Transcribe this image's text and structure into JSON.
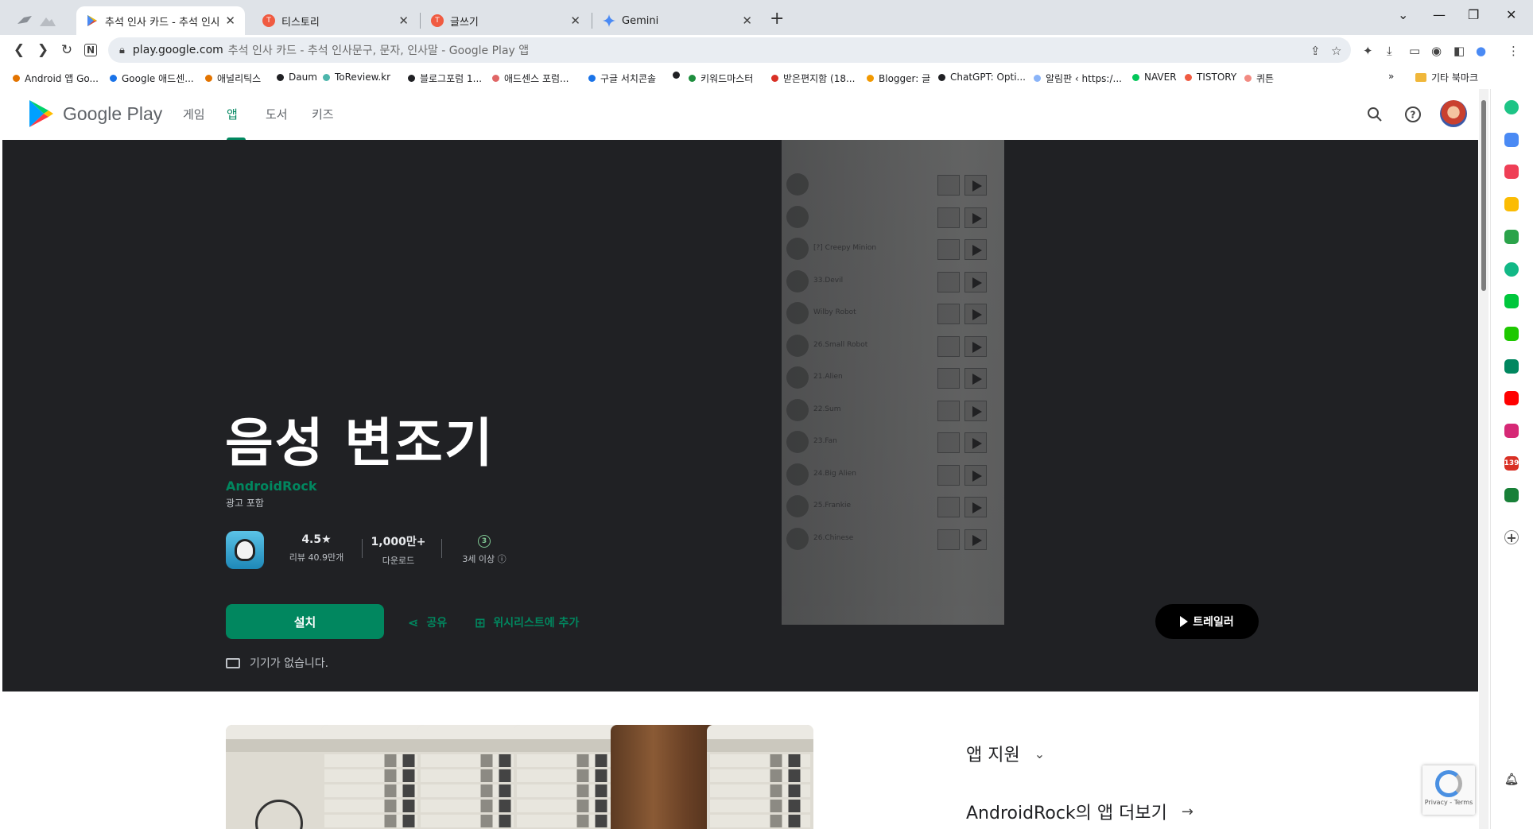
{
  "tabs": [
    {
      "title": "추석 인사 카드 - 추석 인사문구, 문자, 인사말",
      "active": true,
      "favicon_color": "#01875f"
    },
    {
      "title": "티스토리",
      "active": false,
      "favicon_color": "#f05b41"
    },
    {
      "title": "글쓰기",
      "active": false,
      "favicon_color": "#f05b41"
    },
    {
      "title": "Gemini",
      "active": false,
      "favicon_color": "#4a8af4"
    }
  ],
  "omnibox": {
    "host": "play.google.com",
    "path": "추석 인사 카드 - 추석 인사문구, 문자, 인사말 - Google Play 앱"
  },
  "bookmarks": [
    {
      "label": "Android 앱 Go...",
      "color": "#e37400"
    },
    {
      "label": "Google 애드센...",
      "color": "#1a73e8"
    },
    {
      "label": "애널리틱스",
      "color": "#e37400"
    },
    {
      "label": "Daum",
      "color": "#202124"
    },
    {
      "label": "ToReview.kr",
      "color": "#4db6ac"
    },
    {
      "label": "블로그포럼 1...",
      "color": "#202124"
    },
    {
      "label": "애드센스 포럼...",
      "color": "#e06666"
    },
    {
      "label": "구글 서치콘솔",
      "color": "#1a73e8"
    },
    {
      "label": "",
      "color": "#202124"
    },
    {
      "label": "키워드마스터",
      "color": "#1e8e3e"
    },
    {
      "label": "받은편지함 (18...",
      "color": "#d93025"
    },
    {
      "label": "Blogger: 글",
      "color": "#f29900"
    },
    {
      "label": "ChatGPT: Opti...",
      "color": "#202124"
    },
    {
      "label": "알림판 ‹ https:/...",
      "color": "#8ab4f8"
    },
    {
      "label": "NAVER",
      "color": "#03c75a"
    },
    {
      "label": "TISTORY",
      "color": "#f05b41"
    },
    {
      "label": "퀴튼",
      "color": "#f28b82"
    }
  ],
  "bookmarks_more": "»",
  "bookmarks_folder": "기타 북마크",
  "gp": {
    "brand": "Google Play",
    "nav": [
      "게임",
      "앱",
      "도서",
      "키즈"
    ],
    "active_nav": "앱"
  },
  "app": {
    "title": "음성 변조기",
    "developer": "AndroidRock",
    "ads": "광고 포함",
    "rating": "4.5★",
    "reviews": "리뷰 40.9만개",
    "downloads": "1,000만+",
    "downloads_label": "다운로드",
    "age_badge": "3",
    "age_label": "3세 이상 ⓘ",
    "install": "설치",
    "share": "공유",
    "wishlist": "위시리스트에 추가",
    "device_note": "기기가 없습니다.",
    "trailer": "트레일러"
  },
  "hero_list": [
    {
      "label": ""
    },
    {
      "label": ""
    },
    {
      "label": "[?] Creepy Minion"
    },
    {
      "label": "33.Devil"
    },
    {
      "label": "Wilby Robot"
    },
    {
      "label": "26.Small Robot"
    },
    {
      "label": "21.Alien"
    },
    {
      "label": "22.Sum"
    },
    {
      "label": "23.Fan"
    },
    {
      "label": "24.Big Alien"
    },
    {
      "label": "25.Frankie"
    },
    {
      "label": "26.Chinese"
    }
  ],
  "support_heading": "앱 지원",
  "more_from": "AndroidRock의 앱 더보기",
  "recaptcha": "Privacy - Terms",
  "side_icons": [
    {
      "name": "circle-icon",
      "color": "#1ec486"
    },
    {
      "name": "calendar-icon",
      "color": "#4a8af4"
    },
    {
      "name": "pocket-icon",
      "color": "#ef3f56"
    },
    {
      "name": "star-icon",
      "color": "#fbbc04"
    },
    {
      "name": "translate-icon",
      "color": "#2ba34a"
    },
    {
      "name": "circle-play-icon",
      "color": "#12b886"
    },
    {
      "name": "chat-icon",
      "color": "#00c73c"
    },
    {
      "name": "note-icon",
      "color": "#1ec800"
    },
    {
      "name": "play-icon",
      "color": "#01875f"
    },
    {
      "name": "youtube-icon",
      "color": "#ff0000"
    },
    {
      "name": "instagram-icon",
      "color": "#d62976"
    },
    {
      "name": "badge-139",
      "label": "139",
      "color": "#d93025"
    },
    {
      "name": "sheet-icon",
      "color": "#188038"
    }
  ]
}
